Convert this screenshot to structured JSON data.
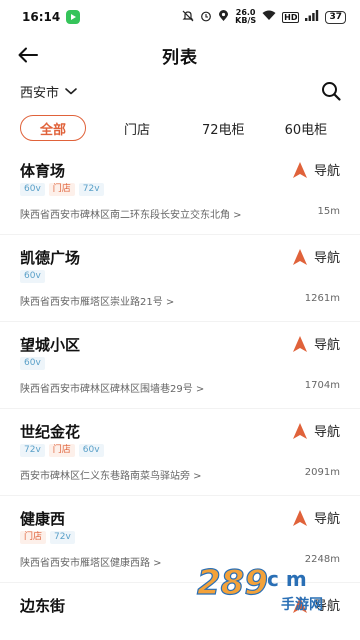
{
  "status_bar": {
    "time": "16:14",
    "net_speed_value": "26.0",
    "net_speed_unit": "KB/S",
    "signal_label": "HD",
    "battery": "37"
  },
  "header": {
    "title": "列表"
  },
  "filter": {
    "city": "西安市"
  },
  "tabs": [
    {
      "label": "全部",
      "active": true
    },
    {
      "label": "门店",
      "active": false
    },
    {
      "label": "72电柜",
      "active": false
    },
    {
      "label": "60电柜",
      "active": false
    }
  ],
  "nav_label": "导航",
  "items": [
    {
      "name": "体育场",
      "tags": [
        "60v",
        "门店",
        "72v"
      ],
      "address": "陕西省西安市碑林区南二环东段长安立交东北角 >",
      "distance": "15m"
    },
    {
      "name": "凯德广场",
      "tags": [
        "60v"
      ],
      "address": "陕西省西安市雁塔区崇业路21号 >",
      "distance": "1261m"
    },
    {
      "name": "望城小区",
      "tags": [
        "60v"
      ],
      "address": "陕西省西安市碑林区碑林区围墙巷29号 >",
      "distance": "1704m"
    },
    {
      "name": "世纪金花",
      "tags": [
        "72v",
        "门店",
        "60v"
      ],
      "address": "西安市碑林区仁义东巷路南菜鸟驿站旁 >",
      "distance": "2091m"
    },
    {
      "name": "健康西",
      "tags": [
        "门店",
        "72v"
      ],
      "address": "陕西省西安市雁塔区健康西路 >",
      "distance": "2248m"
    },
    {
      "name": "边东街",
      "tags": [],
      "address": "",
      "distance": ""
    }
  ],
  "watermark": {
    "brand": "289",
    "suffix": "c m",
    "sub": "手游网"
  },
  "colors": {
    "accent": "#e0623a",
    "tag_blue": "#5aa0c8"
  }
}
